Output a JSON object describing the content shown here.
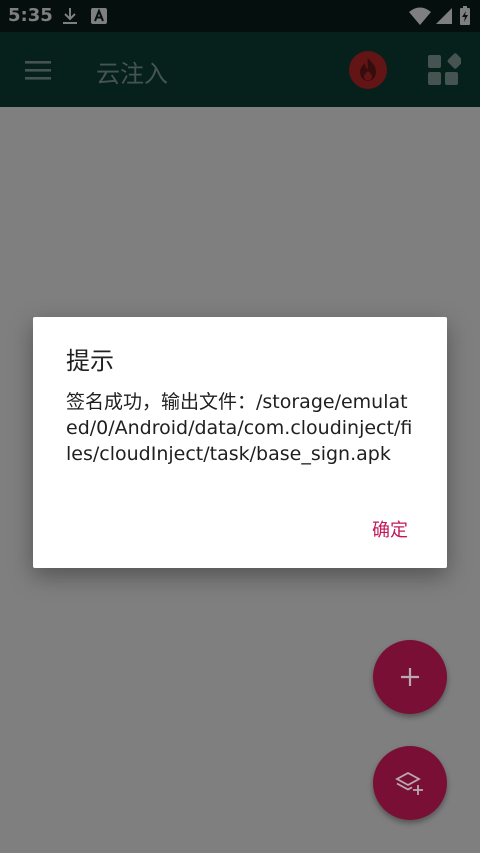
{
  "status_bar": {
    "time": "5:35",
    "icons": [
      "download-icon",
      "keyboard-a-icon",
      "wifi-icon",
      "cellular-signal-icon",
      "battery-charging-icon"
    ]
  },
  "app_bar": {
    "title": "云注入",
    "background": "#0d4038"
  },
  "dialog": {
    "title": "提示",
    "message": "签名成功，输出文件：/storage/emulated/0/Android/data/com.cloudinject/files/cloudInject/task/base_sign.apk",
    "ok_label": "确定",
    "accent": "#c2185b"
  },
  "fabs": [
    "add-icon",
    "layers-add-icon"
  ],
  "colors": {
    "status_bar": "#0a1e1b",
    "fab": "#7a0f36",
    "fire_badge": "#c62828"
  }
}
